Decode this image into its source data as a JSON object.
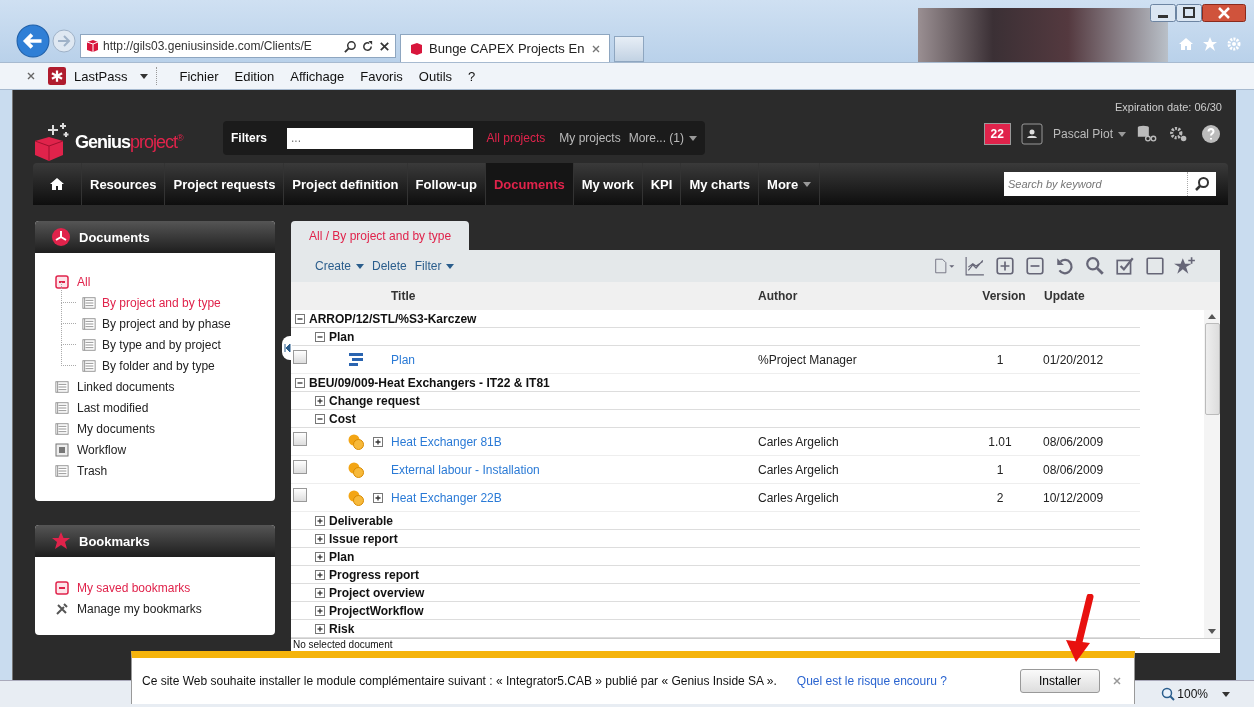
{
  "browser": {
    "address": "http://gils03.geniusinside.com/Clients/E",
    "tabs": [
      {
        "title": "Bunge CAPEX Projects En",
        "selected": true
      }
    ],
    "menu": [
      "Fichier",
      "Edition",
      "Affichage",
      "Favoris",
      "Outils",
      "?"
    ],
    "lastpass": "LastPass"
  },
  "header": {
    "logo_word": "Genius",
    "logo_product": "project",
    "logo_mark": "®",
    "filters_label": "Filters",
    "filter_placeholder": "...",
    "project_filters": [
      {
        "label": "All projects",
        "selected": true
      },
      {
        "label": "My projects",
        "selected": false
      }
    ],
    "more": "More... (1)",
    "expiration": "Expiration date: 06/30",
    "notifications": "22",
    "user": "Pascal Piot"
  },
  "nav": {
    "items": [
      {
        "label": "Resources",
        "selected": false
      },
      {
        "label": "Project requests",
        "selected": false
      },
      {
        "label": "Project definition",
        "selected": false
      },
      {
        "label": "Follow-up",
        "selected": false
      },
      {
        "label": "Documents",
        "selected": true
      },
      {
        "label": "My work",
        "selected": false
      },
      {
        "label": "KPI",
        "selected": false
      },
      {
        "label": "My charts",
        "selected": false
      }
    ],
    "more": "More",
    "search_placeholder": "Search by keyword"
  },
  "documents_panel": {
    "title": "Documents",
    "items": [
      {
        "label": "All",
        "kind": "root",
        "selected": true,
        "children": [
          {
            "label": "By project and by type",
            "selected": true
          },
          {
            "label": "By project and by phase",
            "selected": false
          },
          {
            "label": "By type and by project",
            "selected": false
          },
          {
            "label": "By folder and by type",
            "selected": false
          }
        ]
      },
      {
        "label": "Linked documents",
        "kind": "list",
        "selected": false
      },
      {
        "label": "Last modified",
        "kind": "list",
        "selected": false
      },
      {
        "label": "My documents",
        "kind": "list",
        "selected": false
      },
      {
        "label": "Workflow",
        "kind": "workflow",
        "selected": false
      },
      {
        "label": "Trash",
        "kind": "list",
        "selected": false
      }
    ]
  },
  "bookmarks_panel": {
    "title": "Bookmarks",
    "items": [
      {
        "label": "My saved bookmarks",
        "kind": "saved",
        "selected": true
      },
      {
        "label": "Manage my bookmarks",
        "kind": "manage",
        "selected": false
      }
    ]
  },
  "main": {
    "tab": "All / By project and by type",
    "toolbar": [
      "Create",
      "Delete",
      "Filter"
    ],
    "columns": [
      "Title",
      "Author",
      "Version",
      "Update"
    ],
    "rows": [
      {
        "kind": "project",
        "title": "ARROP/12/STL/%S3-Karczew",
        "expanded": true
      },
      {
        "kind": "folder",
        "title": "Plan",
        "expanded": true
      },
      {
        "kind": "plan_doc",
        "title": "Plan",
        "author": "%Project Manager",
        "version": "1",
        "update": "01/20/2012",
        "checked": false,
        "expandable": false
      },
      {
        "kind": "project",
        "title": "BEU/09/009-Heat Exchangers - IT22 & IT81",
        "expanded": true
      },
      {
        "kind": "folder",
        "title": "Change request",
        "expanded": false
      },
      {
        "kind": "folder",
        "title": "Cost",
        "expanded": true
      },
      {
        "kind": "cost_doc",
        "title": "Heat Exchanger 81B",
        "author": "Carles Argelich",
        "version": "1.01",
        "update": "08/06/2009",
        "checked": false,
        "expandable": true
      },
      {
        "kind": "cost_doc",
        "title": "External labour - Installation",
        "author": "Carles Argelich",
        "version": "1",
        "update": "08/06/2009",
        "checked": false,
        "expandable": false
      },
      {
        "kind": "cost_doc",
        "title": "Heat Exchanger 22B",
        "author": "Carles Argelich",
        "version": "2",
        "update": "10/12/2009",
        "checked": false,
        "expandable": true
      },
      {
        "kind": "folder",
        "title": "Deliverable",
        "expanded": false
      },
      {
        "kind": "folder",
        "title": "Issue report",
        "expanded": false
      },
      {
        "kind": "folder",
        "title": "Plan",
        "expanded": false
      },
      {
        "kind": "folder",
        "title": "Progress report",
        "expanded": false
      },
      {
        "kind": "folder",
        "title": "Project overview",
        "expanded": false
      },
      {
        "kind": "folder",
        "title": "ProjectWorkflow",
        "expanded": false
      },
      {
        "kind": "folder",
        "title": "Risk",
        "expanded": false
      }
    ],
    "status": "No selected document"
  },
  "notification": {
    "message": "Ce site Web souhaite installer le module complémentaire suivant : « Integrator5.CAB » publié par « Genius Inside SA ».",
    "link": "Quel est le risque encouru ?",
    "button": "Installer"
  },
  "status_bar": {
    "zoom": "100%"
  }
}
